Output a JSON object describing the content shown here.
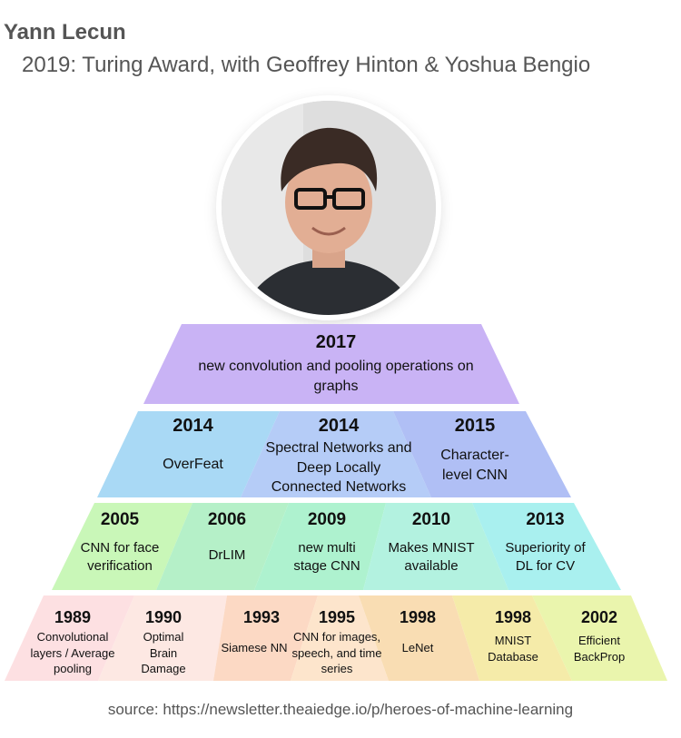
{
  "header": {
    "name": "Yann Lecun",
    "award": "2019: Turing Award, with Geoffrey Hinton & Yoshua Bengio"
  },
  "pyramid": {
    "row1": [
      {
        "year": "2017",
        "desc": "new convolution and pooling operations on graphs",
        "color": "#c9b3f5"
      }
    ],
    "row2": [
      {
        "year": "2014",
        "desc": "OverFeat",
        "color": "#a9d9f5"
      },
      {
        "year": "2014",
        "desc": "Spectral Networks and Deep Locally Connected Networks",
        "color": "#b5ccf7"
      },
      {
        "year": "2015",
        "desc": "Character-level CNN",
        "color": "#b0bff5"
      }
    ],
    "row3": [
      {
        "year": "2005",
        "desc": "CNN for face verification",
        "color": "#c9f7b8"
      },
      {
        "year": "2006",
        "desc": "DrLIM",
        "color": "#b5f0c8"
      },
      {
        "year": "2009",
        "desc": "new multi stage CNN",
        "color": "#aef2cf"
      },
      {
        "year": "2010",
        "desc": "Makes MNIST available",
        "color": "#b3f2e0"
      },
      {
        "year": "2013",
        "desc": "Superiority of DL for CV",
        "color": "#a9f0ef"
      }
    ],
    "row4": [
      {
        "year": "1989",
        "desc": "Convolutional layers / Average pooling",
        "color": "#fde0e2"
      },
      {
        "year": "1990",
        "desc": "Optimal Brain Damage",
        "color": "#fde8e3"
      },
      {
        "year": "1993",
        "desc": "Siamese NN",
        "color": "#fcd9c4"
      },
      {
        "year": "1995",
        "desc": "CNN for images, speech, and time series",
        "color": "#fde5cc"
      },
      {
        "year": "1998",
        "desc": "LeNet",
        "color": "#f9ddb3"
      },
      {
        "year": "1998",
        "desc": "MNIST Database",
        "color": "#f5eba9"
      },
      {
        "year": "2002",
        "desc": "Efficient BackProp",
        "color": "#eaf5ad"
      }
    ]
  },
  "footer": {
    "source": "source: https://newsletter.theaiedge.io/p/heroes-of-machine-learning"
  }
}
